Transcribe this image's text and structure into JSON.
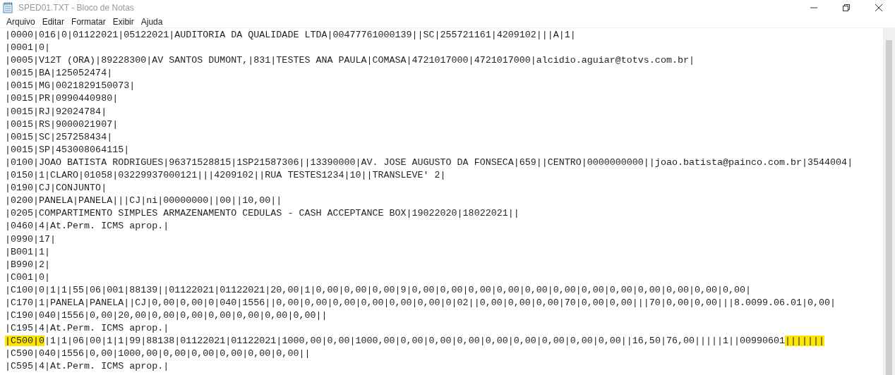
{
  "window": {
    "title": "SPED01.TXT - Bloco de Notas"
  },
  "menu": [
    {
      "label": "Arquivo"
    },
    {
      "label": "Editar"
    },
    {
      "label": "Formatar"
    },
    {
      "label": "Exibir"
    },
    {
      "label": "Ajuda"
    }
  ],
  "lines": [
    {
      "segments": [
        {
          "text": "|0000|016|0|01122021|05122021|AUDITORIA DA QUALIDADE LTDA|00477761000139||SC|255721161|4209102|||A|1|",
          "highlighted": false
        }
      ]
    },
    {
      "segments": [
        {
          "text": "|0001|0|",
          "highlighted": false
        }
      ]
    },
    {
      "segments": [
        {
          "text": "|0005|V12T (ORA)|89228300|AV SANTOS DUMONT,|831|TESTES ANA PAULA|COMASA|4721017000|4721017000|alcidio.aguiar@totvs.com.br|",
          "highlighted": false
        }
      ]
    },
    {
      "segments": [
        {
          "text": "|0015|BA|125052474|",
          "highlighted": false
        }
      ]
    },
    {
      "segments": [
        {
          "text": "|0015|MG|0021829150073|",
          "highlighted": false
        }
      ]
    },
    {
      "segments": [
        {
          "text": "|0015|PR|0990440980|",
          "highlighted": false
        }
      ]
    },
    {
      "segments": [
        {
          "text": "|0015|RJ|92024784|",
          "highlighted": false
        }
      ]
    },
    {
      "segments": [
        {
          "text": "|0015|RS|9000021907|",
          "highlighted": false
        }
      ]
    },
    {
      "segments": [
        {
          "text": "|0015|SC|257258434|",
          "highlighted": false
        }
      ]
    },
    {
      "segments": [
        {
          "text": "|0015|SP|453008064115|",
          "highlighted": false
        }
      ]
    },
    {
      "segments": [
        {
          "text": "|0100|JOAO BATISTA RODRIGUES|96371528815|1SP21587306||13390000|AV. JOSE AUGUSTO DA FONSECA|659||CENTRO|0000000000||joao.batista@painco.com.br|3544004|",
          "highlighted": false
        }
      ]
    },
    {
      "segments": [
        {
          "text": "|0150|1|CLARO|01058|03229937000121|||4209102||RUA TESTES1234|10||TRANSLEVE' 2|",
          "highlighted": false
        }
      ]
    },
    {
      "segments": [
        {
          "text": "|0190|CJ|CONJUNTO|",
          "highlighted": false
        }
      ]
    },
    {
      "segments": [
        {
          "text": "|0200|PANELA|PANELA|||CJ|ni|00000000||00||10,00||",
          "highlighted": false
        }
      ]
    },
    {
      "segments": [
        {
          "text": "|0205|COMPARTIMENTO SIMPLES ARMAZENAMENTO CEDULAS - CASH ACCEPTANCE BOX|19022020|18022021||",
          "highlighted": false
        }
      ]
    },
    {
      "segments": [
        {
          "text": "|0460|4|At.Perm. ICMS aprop.|",
          "highlighted": false
        }
      ]
    },
    {
      "segments": [
        {
          "text": "|0990|17|",
          "highlighted": false
        }
      ]
    },
    {
      "segments": [
        {
          "text": "|B001|1|",
          "highlighted": false
        }
      ]
    },
    {
      "segments": [
        {
          "text": "|B990|2|",
          "highlighted": false
        }
      ]
    },
    {
      "segments": [
        {
          "text": "|C001|0|",
          "highlighted": false
        }
      ]
    },
    {
      "segments": [
        {
          "text": "|C100|0|1|1|55|06|001|88139||01122021|01122021|20,00|1|0,00|0,00|0,00|9|0,00|0,00|0,00|0,00|0,00|0,00|0,00|0,00|0,00|0,00|0,00|0,00|",
          "highlighted": false
        }
      ]
    },
    {
      "segments": [
        {
          "text": "|C170|1|PANELA|PANELA||CJ|0,00|0,00|0|040|1556||0,00|0,00|0,00|0,00|0,00|0,00|0|02||0,00|0,00|0,00|70|0,00|0,00|||70|0,00|0,00|||8.0099.06.01|0,00|",
          "highlighted": false
        }
      ]
    },
    {
      "segments": [
        {
          "text": "|C190|040|1556|0,00|20,00|0,00|0,00|0,00|0,00|0,00|0,00||",
          "highlighted": false
        }
      ]
    },
    {
      "segments": [
        {
          "text": "|C195|4|At.Perm. ICMS aprop.|",
          "highlighted": false
        }
      ]
    },
    {
      "segments": [
        {
          "text": "|C500|0",
          "highlighted": true
        },
        {
          "text": "|1|1|06|00|1|1|99|88138|01122021|01122021|1000,00|0,00|1000,00|0,00|0,00|0,00|0,00|0,00|0,00|0,00|0,00||16,50|76,00|||||1||00990601",
          "highlighted": false
        },
        {
          "text": "|||||||",
          "highlighted": true
        }
      ]
    },
    {
      "segments": [
        {
          "text": "|C590|040|1556|0,00|1000,00|0,00|0,00|0,00|0,00|0,00||",
          "highlighted": false
        }
      ]
    },
    {
      "segments": [
        {
          "text": "|C595|4|At.Perm. ICMS aprop.|",
          "highlighted": false
        }
      ]
    }
  ]
}
